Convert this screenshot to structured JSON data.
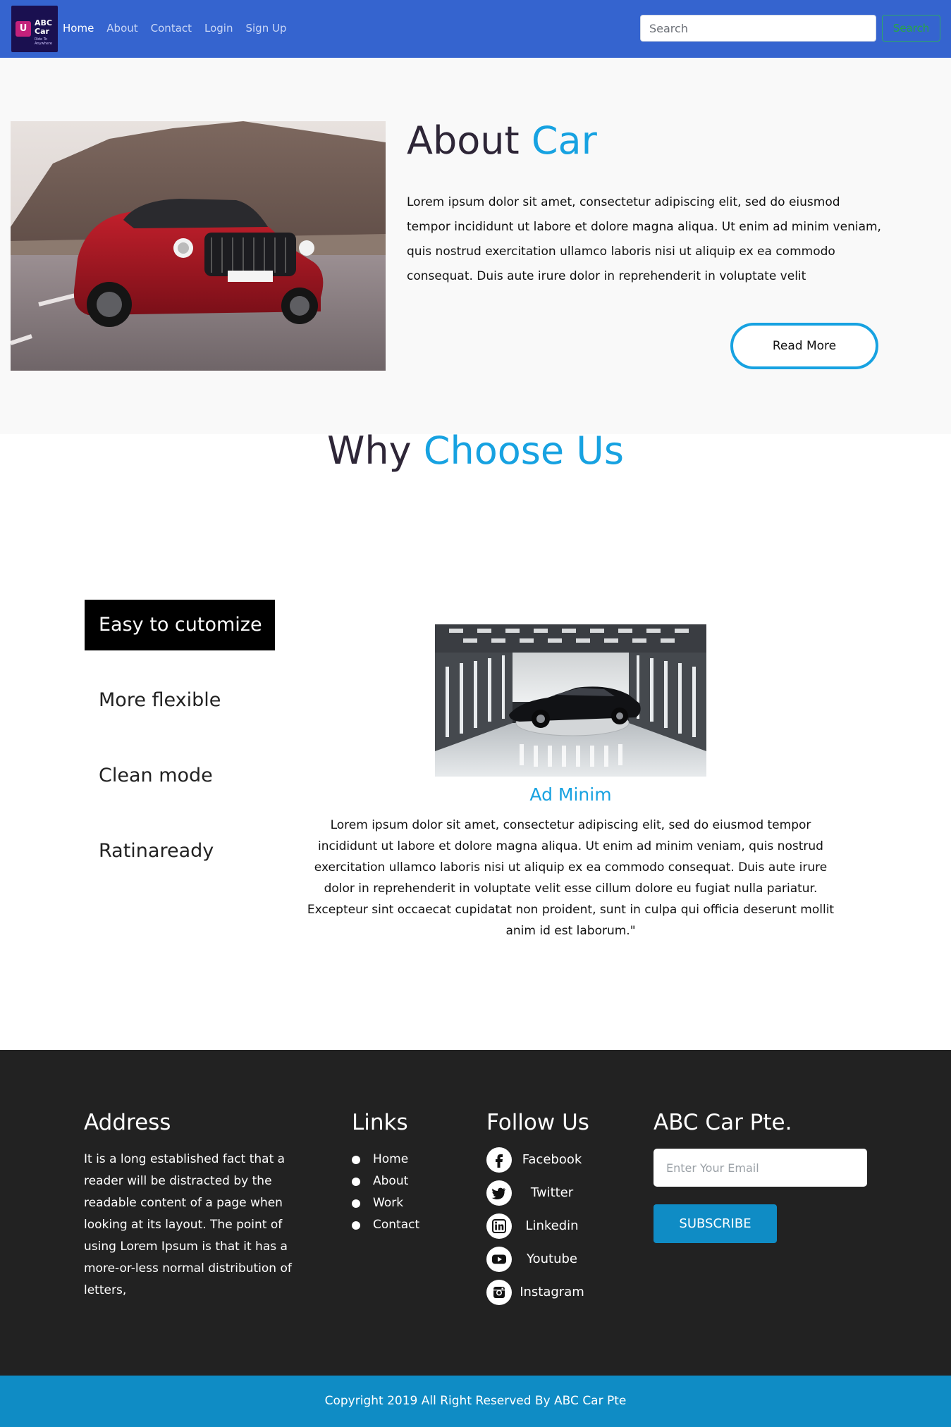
{
  "navbar": {
    "logo": {
      "line1": "ABC",
      "line2": "Car",
      "tagline": "Ride To Anywhere"
    },
    "links": [
      "Home",
      "About",
      "Contact",
      "Login",
      "Sign Up"
    ],
    "search": {
      "placeholder": "Search",
      "button_label": "Search"
    },
    "colors": {
      "background": "#3564cf",
      "search_button": "#28a745"
    }
  },
  "about": {
    "title_plain": "About",
    "title_accent": "Car",
    "text": "Lorem ipsum dolor sit amet, consectetur adipiscing elit, sed do eiusmod tempor incididunt ut labore et dolore magna aliqua. Ut enim ad minim veniam, quis nostrud exercitation ullamco laboris nisi ut aliquip ex ea commodo consequat. Duis aute irure dolor in reprehenderit in voluptate velit",
    "read_more_label": "Read More",
    "image": "red-luxury-sedan-on-mountain-road"
  },
  "why": {
    "title_plain": "Why",
    "title_accent": "Choose Us",
    "tabs": [
      "Easy to cutomize",
      "More flexible",
      "Clean mode",
      "Ratinaready"
    ],
    "active_tab": "Easy to cutomize",
    "feature": {
      "image": "black-sports-car-in-showroom",
      "title": "Ad Minim",
      "text": "Lorem ipsum dolor sit amet, consectetur adipiscing elit, sed do eiusmod tempor incididunt ut labore et dolore magna aliqua. Ut enim ad minim veniam, quis nostrud exercitation ullamco laboris nisi ut aliquip ex ea commodo consequat. Duis aute irure dolor in reprehenderit in voluptate velit esse cillum dolore eu fugiat nulla pariatur. Excepteur sint occaecat cupidatat non proident, sunt in culpa qui officia deserunt mollit anim id est laborum.\""
    }
  },
  "footer": {
    "address": {
      "title": "Address",
      "text": "It is a long established fact that a reader will be distracted by the readable content of a page when looking at its layout. The point of using Lorem Ipsum is that it has a more-or-less normal distribution of letters,"
    },
    "links": {
      "title": "Links",
      "items": [
        "Home",
        "About",
        "Work",
        "Contact"
      ]
    },
    "follow": {
      "title": "Follow Us",
      "items": [
        {
          "label": "Facebook",
          "icon": "facebook-icon"
        },
        {
          "label": "Twitter",
          "icon": "twitter-icon"
        },
        {
          "label": "Linkedin",
          "icon": "linkedin-icon"
        },
        {
          "label": "Youtube",
          "icon": "youtube-icon"
        },
        {
          "label": "Instagram",
          "icon": "instagram-icon"
        }
      ]
    },
    "subscribe": {
      "title": "ABC Car Pte.",
      "email_placeholder": "Enter Your Email",
      "button_label": "SUBSCRIBE"
    },
    "copyright": "Copyright 2019 All Right Reserved By ABC Car Pte",
    "colors": {
      "background": "#222222",
      "accent": "#0f8cc5"
    }
  },
  "colors": {
    "accent": "#17a2e1",
    "heading": "#2e2637"
  }
}
